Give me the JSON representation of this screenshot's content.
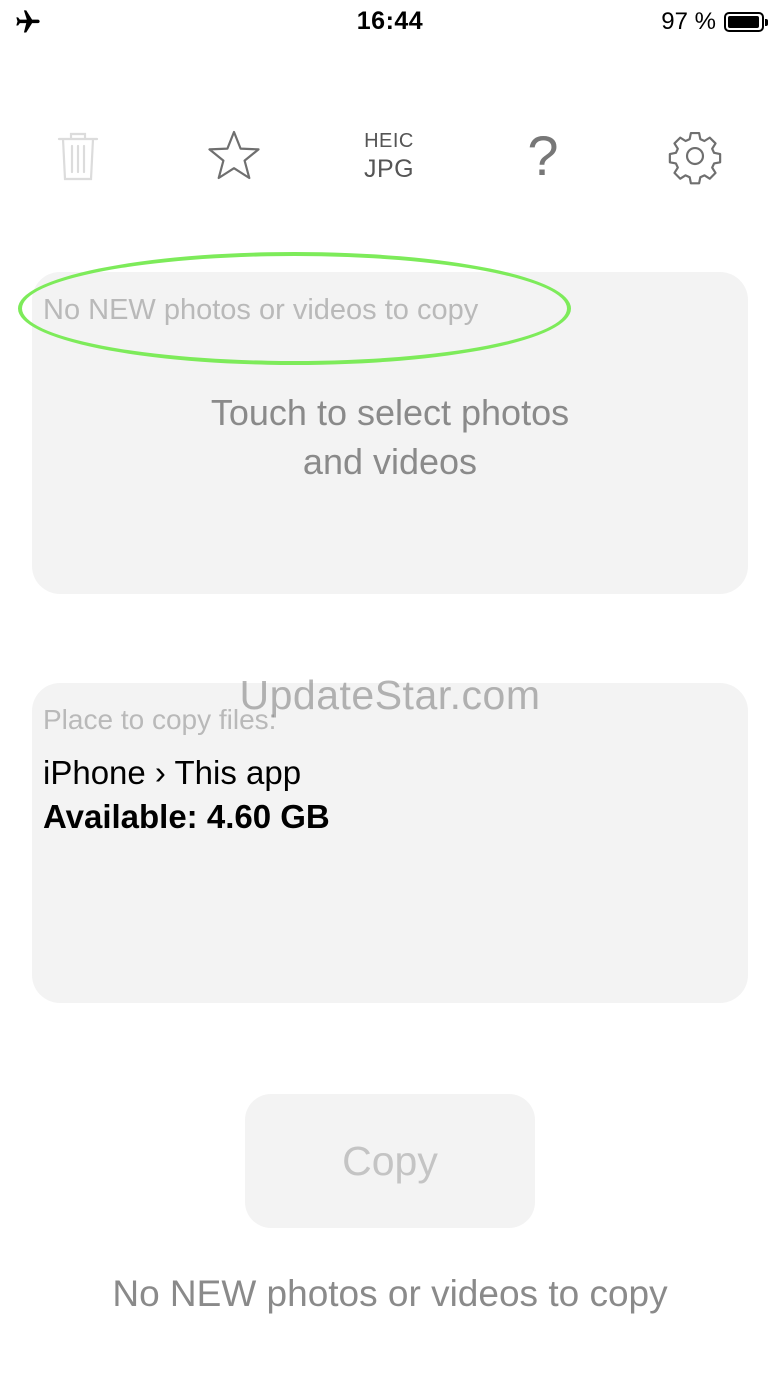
{
  "status_bar": {
    "time": "16:44",
    "battery_percent_label": "97 %",
    "battery_level": 0.97,
    "airplane_mode_icon": "airplane-icon"
  },
  "toolbar": {
    "trash_icon": "trash-icon",
    "favorites_icon": "star-icon",
    "format_top": "HEIC",
    "format_bottom": "JPG",
    "help_label": "?",
    "settings_icon": "gear-icon"
  },
  "select_card": {
    "status": "No NEW photos or videos to copy",
    "prompt_line1": "Touch to select photos",
    "prompt_line2": "and videos"
  },
  "watermark": "UpdateStar.com",
  "destination": {
    "label": "Place to copy files:",
    "path": "iPhone › This app",
    "available": "Available: 4.60 GB"
  },
  "copy_button": {
    "label": "Copy"
  },
  "bottom_status": "No NEW photos or videos to copy",
  "colors": {
    "highlight_ring": "#7deb5a",
    "card_background": "#f3f3f3",
    "muted_text": "#8a8a8a"
  }
}
